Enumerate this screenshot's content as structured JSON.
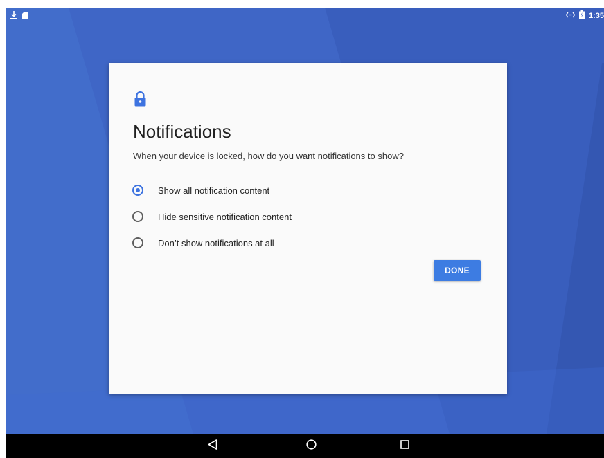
{
  "status_bar": {
    "time": "1:35",
    "left_icons": [
      "download-icon",
      "sd-card-icon"
    ],
    "right_icons": [
      "data-transfer-icon",
      "battery-icon"
    ]
  },
  "dialog": {
    "icon": "lock-icon",
    "title": "Notifications",
    "subtitle": "When your device is locked, how do you want notifications to show?",
    "options": [
      {
        "label": "Show all notification content",
        "checked": true
      },
      {
        "label": "Hide sensitive notification content",
        "checked": false
      },
      {
        "label": "Don’t show notifications at all",
        "checked": false
      }
    ],
    "done_label": "DONE"
  },
  "nav_bar": {
    "buttons": [
      "back-icon",
      "home-icon",
      "recents-icon"
    ]
  },
  "colors": {
    "wallpaper": "#3f66c6",
    "accent": "#3d73e0",
    "button": "#3d7ce2",
    "dialog_bg": "#fafafa",
    "nav_bar": "#000000"
  }
}
